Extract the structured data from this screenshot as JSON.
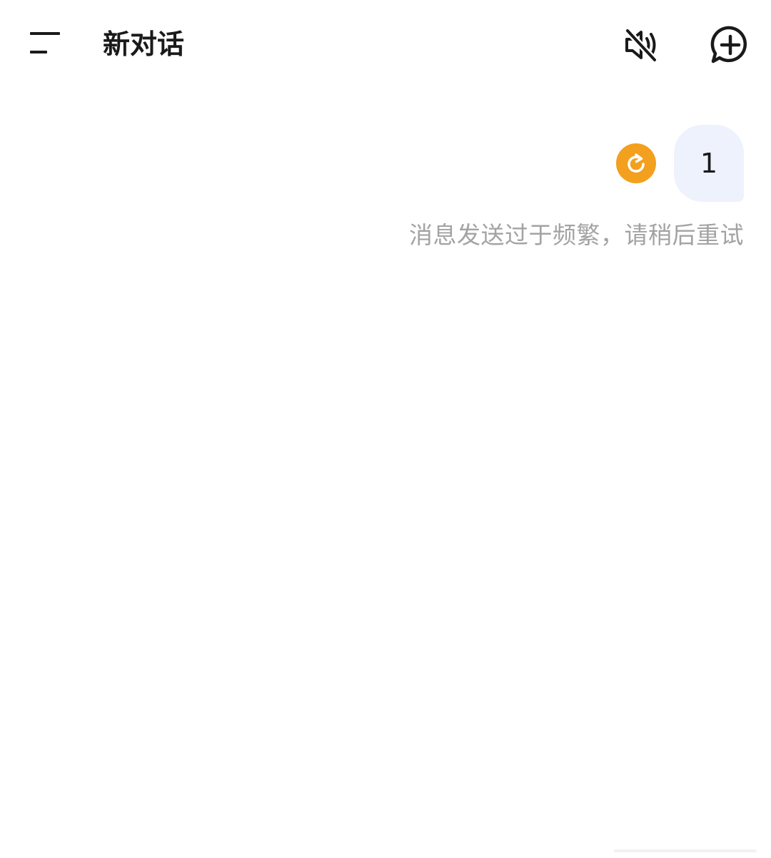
{
  "header": {
    "title": "新对话",
    "menu_icon": "menu-icon",
    "mute_icon": "speaker-muted-icon",
    "new_chat_icon": "chat-plus-icon"
  },
  "conversation": {
    "messages": [
      {
        "role": "user",
        "text": "1",
        "status": "failed",
        "error": "消息发送过于频繁，请稍后重试",
        "retry_icon": "refresh-icon"
      }
    ]
  },
  "colors": {
    "bubble_bg": "#edf2fd",
    "retry_bg": "#f3a01f",
    "error_text": "#a3a3a3",
    "title_text": "#1a1a1a"
  }
}
